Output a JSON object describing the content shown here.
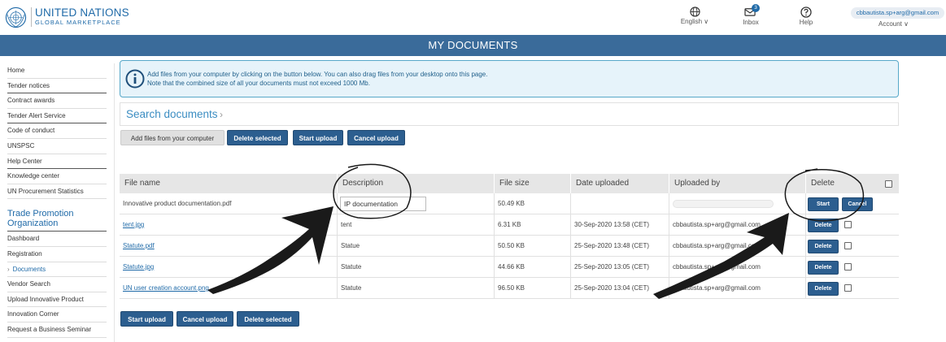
{
  "brand": {
    "line1": "UNITED NATIONS",
    "line2": "GLOBAL MARKETPLACE"
  },
  "header": {
    "language": "English ∨",
    "inbox_label": "Inbox",
    "inbox_count": "3",
    "help_label": "Help",
    "email": "cbbautista.sp+arg@gmail.com",
    "account": "Account ∨"
  },
  "page_title": "MY DOCUMENTS",
  "sidebar": {
    "items_top": [
      "Home",
      "Tender notices",
      "Contract awards",
      "Tender Alert Service",
      "Code of conduct",
      "UNSPSC",
      "Help Center",
      "Knowledge center",
      "UN Procurement Statistics"
    ],
    "org_heading": "Trade Promotion Organization",
    "items_org": [
      "Dashboard",
      "Registration",
      "Documents",
      "Vendor Search",
      "Upload Innovative Product",
      "Innovation Corner",
      "Request a Business Seminar"
    ],
    "active_chevron": "›"
  },
  "info": {
    "line1": "Add files from your computer by clicking on the button below. You can also drag files from your desktop onto this page.",
    "line2": "Note that the combined size of all your documents must not exceed 1000 Mb."
  },
  "search": {
    "label": "Search documents",
    "chevron": "›"
  },
  "toolbar": {
    "add_files": "Add files from your computer",
    "delete_selected": "Delete selected",
    "start_upload": "Start upload",
    "cancel_upload": "Cancel upload"
  },
  "table": {
    "columns": [
      "File name",
      "Description",
      "File size",
      "Date uploaded",
      "Uploaded by",
      "Delete"
    ],
    "pending": {
      "file": "Innovative product documentation.pdf",
      "description": "IP documentation",
      "size": "50.49 KB",
      "start": "Start",
      "cancel": "Cancel"
    },
    "rows": [
      {
        "file": "tent.jpg",
        "description": "tent",
        "size": "6.31 KB",
        "date": "30-Sep-2020 13:58 (CET)",
        "by": "cbbautista.sp+arg@gmail.com",
        "delete": "Delete"
      },
      {
        "file": "Statute.pdf",
        "description": "Statue",
        "size": "50.50 KB",
        "date": "25-Sep-2020 13:48 (CET)",
        "by": "cbbautista.sp+arg@gmail.com",
        "delete": "Delete"
      },
      {
        "file": "Statute.jpg",
        "description": "Statute",
        "size": "44.66 KB",
        "date": "25-Sep-2020 13:05 (CET)",
        "by": "cbbautista.sp+arg@gmail.com",
        "delete": "Delete"
      },
      {
        "file": "UN user creation account.png",
        "description": "Statute",
        "size": "96.50 KB",
        "date": "25-Sep-2020 13:04 (CET)",
        "by": "cbbautista.sp+arg@gmail.com",
        "delete": "Delete"
      }
    ]
  },
  "bottom": {
    "start_upload": "Start upload",
    "cancel_upload": "Cancel upload",
    "delete_selected": "Delete selected"
  },
  "colors": {
    "primary": "#2c5e8f",
    "title_bar": "#3a6b9a",
    "link": "#1f6aa8",
    "info_bg": "#e6f3fa"
  },
  "icons": [
    "un-emblem-icon",
    "globe-icon",
    "inbox-icon",
    "help-icon",
    "info-icon",
    "chevron-right-icon"
  ]
}
